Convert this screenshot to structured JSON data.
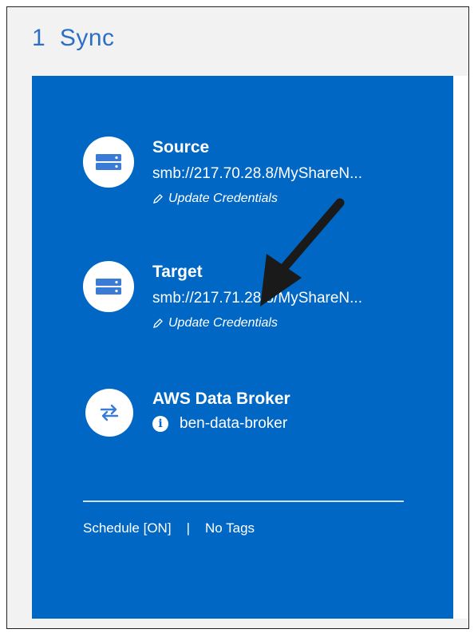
{
  "header": {
    "count": "1",
    "title": "Sync"
  },
  "source": {
    "title": "Source",
    "url": "smb://217.70.28.8/MyShareN...",
    "update_label": "Update Credentials",
    "icon": "server-icon"
  },
  "target": {
    "title": "Target",
    "url": "smb://217.71.28.8/MyShareN...",
    "update_label": "Update Credentials",
    "icon": "server-icon"
  },
  "broker": {
    "title": "AWS Data Broker",
    "name": "ben-data-broker",
    "icon": "swap-arrows-icon",
    "info_icon": "info-icon"
  },
  "footer": {
    "schedule": "Schedule [ON]",
    "separator": "|",
    "tags": "No Tags"
  },
  "colors": {
    "card_blue": "#0067c5",
    "title_blue": "#2d6fc4",
    "arrow": "#1a1a1a"
  }
}
